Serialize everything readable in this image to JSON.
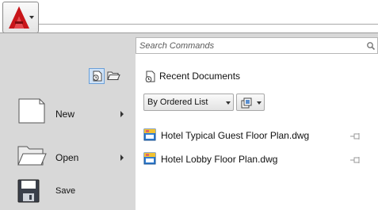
{
  "app": {
    "logo_letter": "A",
    "accent": "#c8151a"
  },
  "search": {
    "placeholder": "Search Commands"
  },
  "commands": [
    {
      "label": "New",
      "has_submenu": true,
      "icon": "blank-document-icon"
    },
    {
      "label": "Open",
      "has_submenu": true,
      "icon": "open-folder-icon"
    },
    {
      "label": "Save",
      "has_submenu": false,
      "icon": "floppy-disk-icon"
    }
  ],
  "recent": {
    "title": "Recent Documents",
    "sort_label": "By Ordered List",
    "documents": [
      {
        "name": "Hotel Typical Guest Floor Plan.dwg"
      },
      {
        "name": "Hotel Lobby Floor Plan.dwg"
      }
    ]
  }
}
